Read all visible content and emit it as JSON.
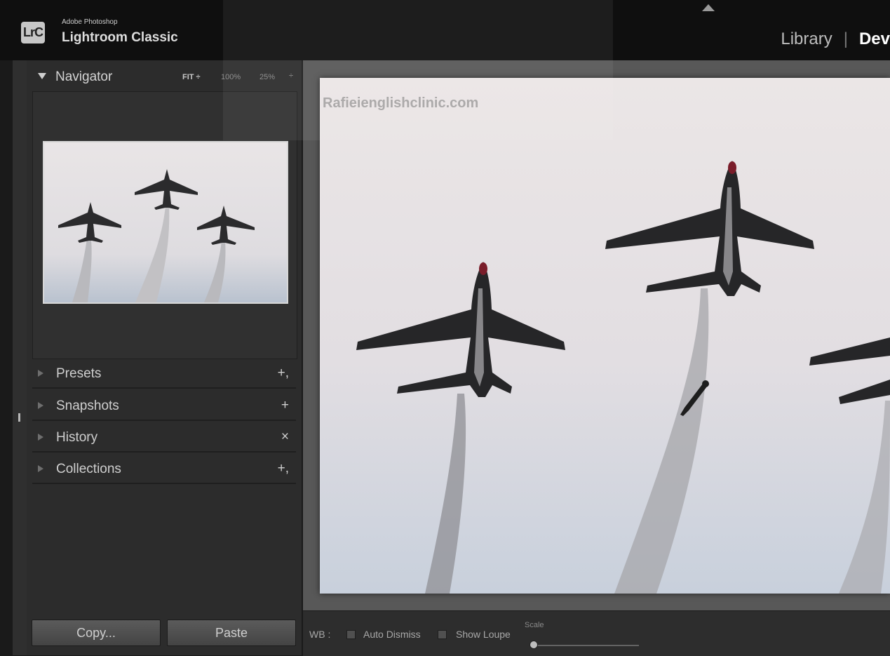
{
  "app": {
    "brand_top": "Adobe Photoshop",
    "brand_main": "Lightroom Classic",
    "logo_text": "LrC"
  },
  "modules": {
    "library": "Library",
    "separator": "|",
    "develop": "Dev"
  },
  "navigator": {
    "title": "Navigator",
    "zoom_fit": "FIT ÷",
    "zoom_100": "100%",
    "zoom_25": "25%",
    "zoom_stepper": "÷"
  },
  "panels": [
    {
      "label": "Presets",
      "action": "+,"
    },
    {
      "label": "Snapshots",
      "action": "+"
    },
    {
      "label": "History",
      "action": "×"
    },
    {
      "label": "Collections",
      "action": "+,"
    }
  ],
  "buttons": {
    "copy": "Copy...",
    "paste": "Paste"
  },
  "toolbar": {
    "wb": "WB :",
    "auto_dismiss": "Auto Dismiss",
    "show_loupe": "Show Loupe",
    "scale": "Scale"
  },
  "watermark": "Rafieienglishclinic.com"
}
